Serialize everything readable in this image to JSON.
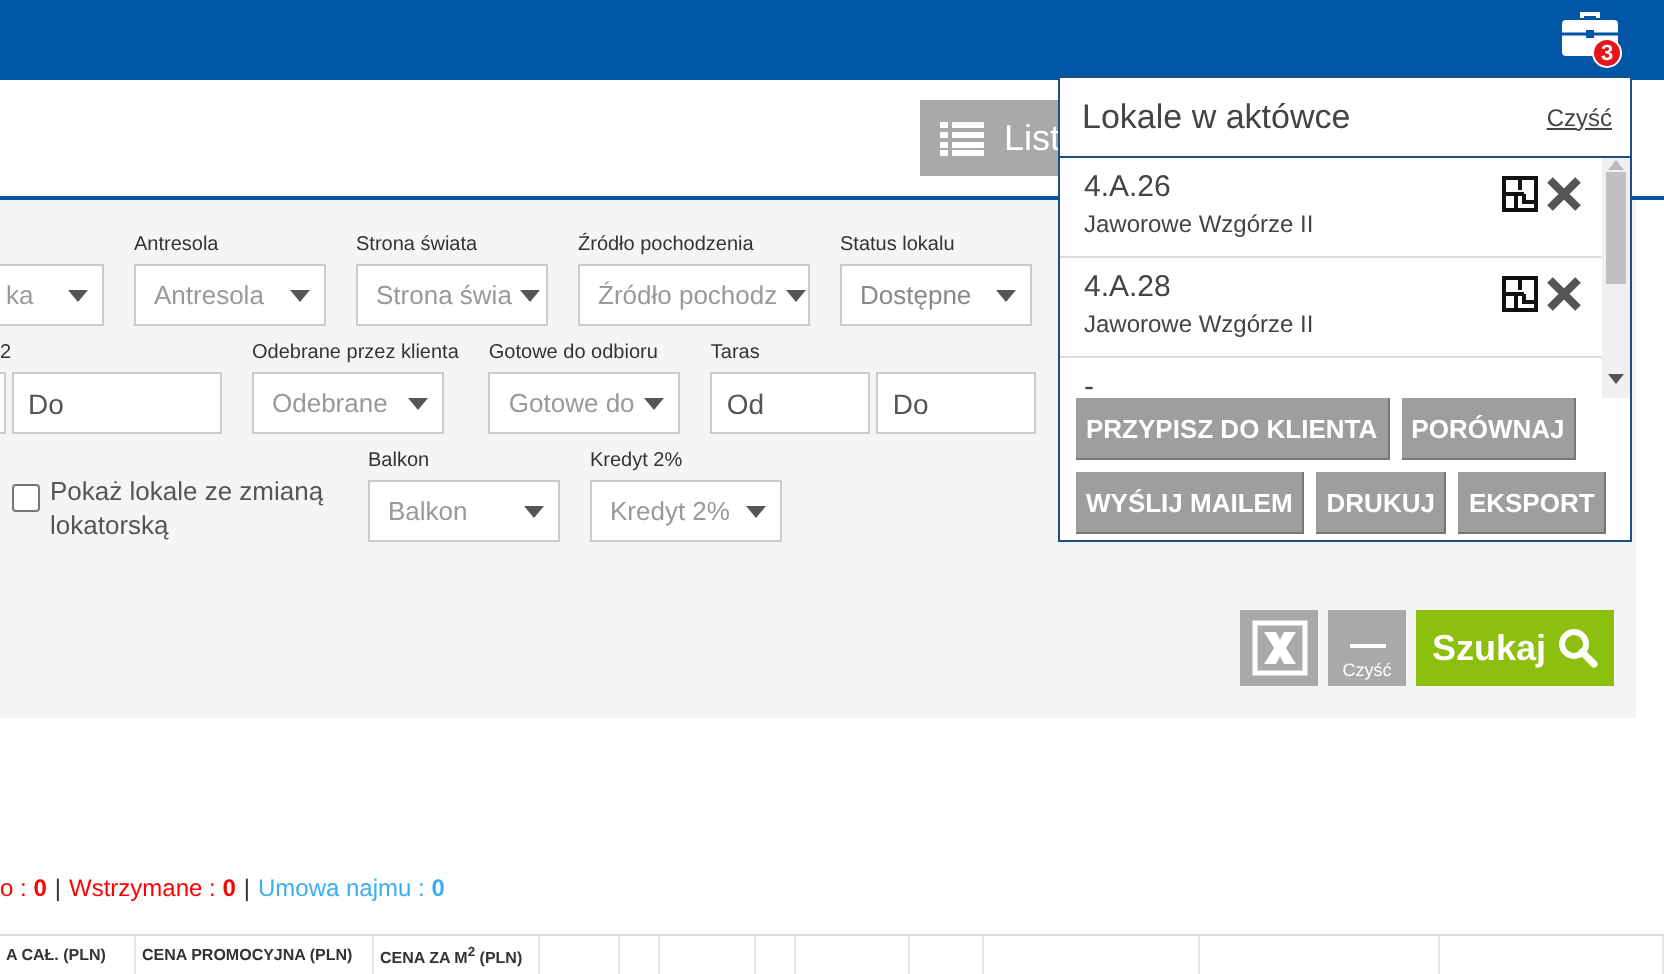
{
  "header": {
    "briefcase_count": "3"
  },
  "toolbar": {
    "list_button": "List"
  },
  "filters": {
    "rows": [
      [
        {
          "kind": "select",
          "placeholder": "ka"
        },
        {
          "kind": "select",
          "label": "Antresola",
          "placeholder": "Antresola"
        },
        {
          "kind": "select",
          "label": "Strona świata",
          "placeholder": "Strona świa"
        },
        {
          "kind": "select",
          "label": "Źródło pochodzenia",
          "placeholder": "Źródło pochodz"
        },
        {
          "kind": "select",
          "label": "Status lokalu",
          "value": "Dostępne"
        }
      ],
      [
        {
          "kind": "range",
          "label": "2",
          "cut": true,
          "placeholders": [
            "Do"
          ]
        },
        {
          "kind": "select",
          "label": "Odebrane przez klienta",
          "placeholder": "Odebrane"
        },
        {
          "kind": "select",
          "label": "Gotowe do odbioru",
          "placeholder": "Gotowe do"
        },
        {
          "kind": "range",
          "label": "Taras",
          "placeholders": [
            "Od",
            "Do"
          ]
        }
      ],
      [
        {
          "kind": "checkbox",
          "label": "Pokaż lokale ze zmianą lokatorską",
          "checked": false
        },
        {
          "kind": "select",
          "label": "Balkon",
          "placeholder": "Balkon"
        },
        {
          "kind": "select",
          "label": "Kredyt 2%",
          "placeholder": "Kredyt 2%"
        }
      ]
    ]
  },
  "actions": {
    "clear_label": "Czyść",
    "search_label": "Szukaj"
  },
  "statuses": [
    {
      "text": "o : ",
      "value": "0",
      "color": "#ff0000"
    },
    {
      "separator": "|",
      "text": "Wstrzymane : ",
      "value": "0",
      "color": "#ff0000"
    },
    {
      "separator": "|",
      "text": "Umowa najmu : ",
      "value": "0",
      "color": "#3aaef2"
    }
  ],
  "table": {
    "columns": [
      "A CAŁ. (PLN)",
      "CENA PROMOCYJNA (PLN)",
      "CENA ZA M$^{2}$ (PLN)"
    ]
  },
  "briefcase": {
    "title": "Lokale w aktówce",
    "clear_link": "Czyść",
    "items": [
      {
        "name": "4.A.26",
        "project": "Jaworowe Wzgórze II"
      },
      {
        "name": "4.A.28",
        "project": "Jaworowe Wzgórze II"
      },
      {
        "name": "-"
      }
    ],
    "buttons": [
      "PRZYPISZ DO KLIENTA",
      "PORÓWNAJ",
      "WYŚLIJ MAILEM",
      "DRUKUJ",
      "EKSPORT"
    ]
  }
}
